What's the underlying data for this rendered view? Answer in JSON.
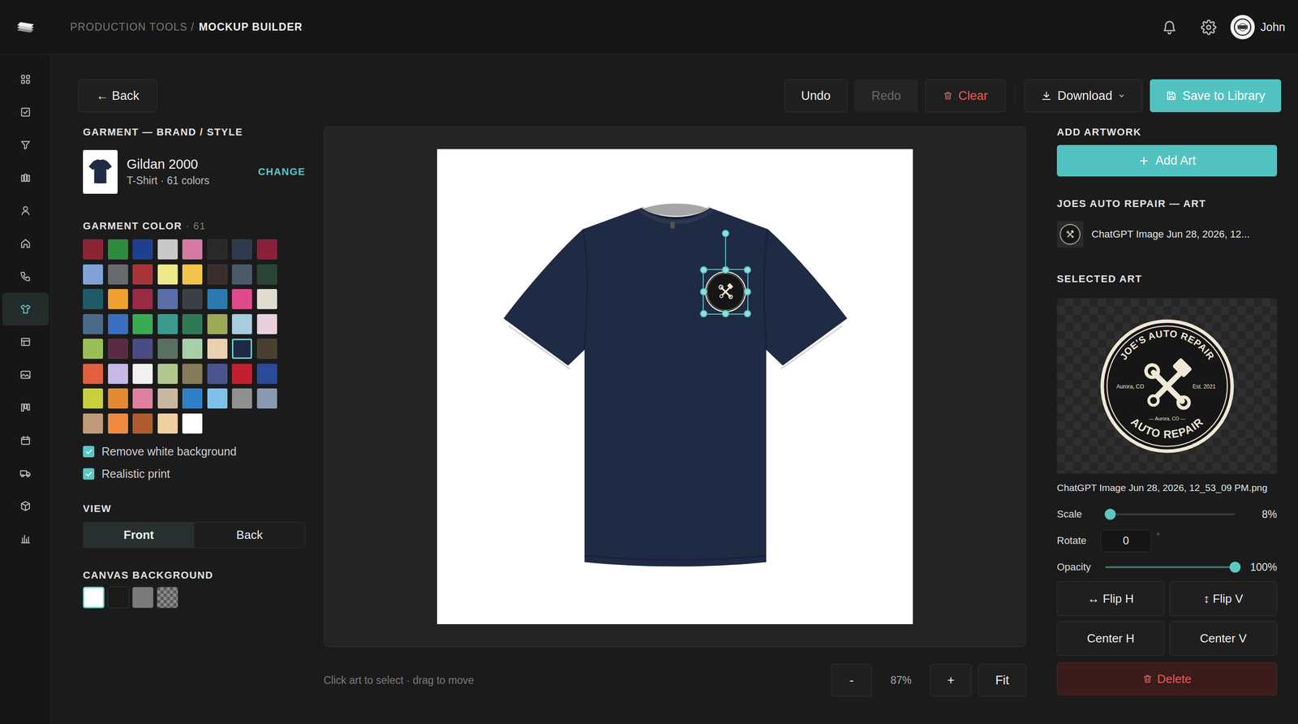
{
  "topbar": {
    "breadcrumb_parent": "PRODUCTION TOOLS /",
    "breadcrumb_current": "MOCKUP BUILDER",
    "user": "John"
  },
  "sidebar": {
    "items": [
      {
        "selected": false
      },
      {
        "selected": false
      },
      {
        "selected": false
      },
      {
        "selected": false
      },
      {
        "selected": false
      },
      {
        "selected": false
      },
      {
        "selected": false
      },
      {
        "selected": true
      },
      {
        "selected": false
      },
      {
        "selected": false
      },
      {
        "selected": false
      },
      {
        "selected": false
      },
      {
        "selected": false
      },
      {
        "selected": false
      },
      {
        "selected": false
      }
    ]
  },
  "toolbar": {
    "back": "← Back",
    "undo": {
      "label": "Undo",
      "disabled": false
    },
    "redo": {
      "label": "Redo",
      "disabled": true
    },
    "clear": "Clear",
    "download": "Download",
    "save": "Save to Library"
  },
  "garment": {
    "heading": "GARMENT — BRAND / STYLE",
    "name": "Gildan 2000",
    "subtitle": "T-Shirt · 61 colors",
    "change": "CHANGE"
  },
  "garment_color": {
    "heading": "GARMENT COLOR",
    "count": "· 61",
    "swatches": [
      {
        "color": "#8b2333",
        "selected": false
      },
      {
        "color": "#2e8b3e",
        "selected": false
      },
      {
        "color": "#1f3f8f",
        "selected": false
      },
      {
        "color": "#c8c8c8",
        "selected": false
      },
      {
        "color": "#d47aa3",
        "selected": false
      },
      {
        "color": "#2a2a2a",
        "selected": false
      },
      {
        "color": "#2d3b4d",
        "selected": false
      },
      {
        "color": "#8a1f3a",
        "selected": false
      },
      {
        "color": "#7fa3d9",
        "selected": false
      },
      {
        "color": "#666a6e",
        "selected": false
      },
      {
        "color": "#a8343a",
        "selected": false
      },
      {
        "color": "#ede88a",
        "selected": false
      },
      {
        "color": "#f2c44c",
        "selected": false
      },
      {
        "color": "#3a2e2c",
        "selected": false
      },
      {
        "color": "#4a5a6a",
        "selected": false
      },
      {
        "color": "#2a4535",
        "selected": false
      },
      {
        "color": "#1f5a6a",
        "selected": false
      },
      {
        "color": "#f0a030",
        "selected": false
      },
      {
        "color": "#9a2a45",
        "selected": false
      },
      {
        "color": "#5a6fa8",
        "selected": false
      },
      {
        "color": "#3a4045",
        "selected": false
      },
      {
        "color": "#2a7ab0",
        "selected": false
      },
      {
        "color": "#e04a8a",
        "selected": false
      },
      {
        "color": "#e0dccf",
        "selected": false
      },
      {
        "color": "#4a6a8a",
        "selected": false
      },
      {
        "color": "#3a6fc0",
        "selected": false
      },
      {
        "color": "#3aaa55",
        "selected": false
      },
      {
        "color": "#3a9a90",
        "selected": false
      },
      {
        "color": "#2f7a55",
        "selected": false
      },
      {
        "color": "#9aaa55",
        "selected": false
      },
      {
        "color": "#a8cce0",
        "selected": false
      },
      {
        "color": "#e8d0dc",
        "selected": false
      },
      {
        "color": "#9ac055",
        "selected": false
      },
      {
        "color": "#5a2a45",
        "selected": false
      },
      {
        "color": "#4a4a85",
        "selected": false
      },
      {
        "color": "#5a7060",
        "selected": false
      },
      {
        "color": "#a8d0a8",
        "selected": false
      },
      {
        "color": "#e8d0b0",
        "selected": false
      },
      {
        "color": "#1f2a45",
        "selected": true
      },
      {
        "color": "#4a4030",
        "selected": false
      },
      {
        "color": "#e06040",
        "selected": false
      },
      {
        "color": "#c8b8e8",
        "selected": false
      },
      {
        "color": "#f0f0f0",
        "selected": false
      },
      {
        "color": "#b0c890",
        "selected": false
      },
      {
        "color": "#857a5a",
        "selected": false
      },
      {
        "color": "#4a5590",
        "selected": false
      },
      {
        "color": "#c02030",
        "selected": false
      },
      {
        "color": "#2a4a9a",
        "selected": false
      },
      {
        "color": "#c8d040",
        "selected": false
      },
      {
        "color": "#e58a30",
        "selected": false
      },
      {
        "color": "#e080a0",
        "selected": false
      },
      {
        "color": "#c8b8a0",
        "selected": false
      },
      {
        "color": "#3080c8",
        "selected": false
      },
      {
        "color": "#80c0e8",
        "selected": false
      },
      {
        "color": "#909090",
        "selected": false
      },
      {
        "color": "#8898b0",
        "selected": false
      },
      {
        "color": "#c09a78",
        "selected": false
      },
      {
        "color": "#f08a40",
        "selected": false
      },
      {
        "color": "#b05a30",
        "selected": false
      },
      {
        "color": "#f0d0a0",
        "selected": false
      },
      {
        "color": "#ffffff",
        "selected": false
      }
    ]
  },
  "options": [
    {
      "label": "Remove white background",
      "checked": true
    },
    {
      "label": "Realistic print",
      "checked": true
    }
  ],
  "view": {
    "heading": "VIEW",
    "options": [
      {
        "label": "Front",
        "selected": true
      },
      {
        "label": "Back",
        "selected": false
      }
    ]
  },
  "canvas_background": {
    "heading": "CANVAS BACKGROUND",
    "swatches": [
      {
        "kind": "solid",
        "color": "#ffffff",
        "selected": true
      },
      {
        "kind": "solid",
        "color": "#1a1a1a",
        "selected": false
      },
      {
        "kind": "solid",
        "color": "#7a7a7a",
        "selected": false
      },
      {
        "kind": "checker",
        "selected": false
      }
    ]
  },
  "canvas": {
    "hint": "Click art to select · drag to move",
    "zoom_out": "-",
    "zoom": "87%",
    "zoom_in": "+",
    "fit": "Fit"
  },
  "artwork": {
    "heading": "ADD ARTWORK",
    "add_button": "Add Art",
    "list_heading": "JOES AUTO REPAIR — ART",
    "items": [
      {
        "name": "ChatGPT Image Jun 28, 2026, 12..."
      }
    ]
  },
  "selected_art": {
    "heading": "SELECTED ART",
    "artwork_text": {
      "top": "JOE'S AUTO REPAIR",
      "left": "Aurora, CO",
      "right": "Est. 2021",
      "middle": "— Aurora, CO —",
      "bottom": "AUTO REPAIR"
    },
    "filename": "ChatGPT Image Jun 28, 2026, 12_53_09 PM.png",
    "scale": {
      "label": "Scale",
      "level": 0.04,
      "reading": "8%"
    },
    "rotate": {
      "label": "Rotate",
      "value": "0",
      "unit": "°"
    },
    "opacity": {
      "label": "Opacity",
      "level": 1,
      "reading": "100%"
    },
    "flip_h": "↔ Flip H",
    "flip_v": "↕ Flip V",
    "center_h": "Center H",
    "center_v": "Center V",
    "delete": "Delete"
  }
}
